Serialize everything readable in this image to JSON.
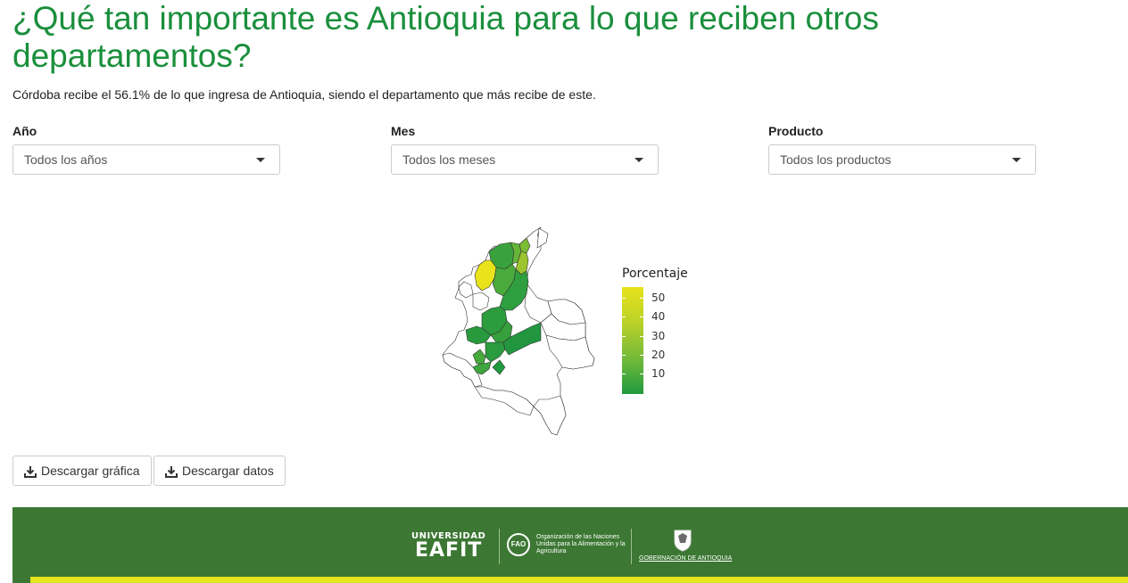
{
  "header": {
    "title": "¿Qué tan importante es Antioquia para lo que reciben otros departamentos?",
    "subtitle": "Córdoba recibe el 56.1% de lo que ingresa de Antioquia, siendo el departamento que más recibe de este."
  },
  "filters": {
    "year": {
      "label": "Año",
      "value": "Todos los años"
    },
    "month": {
      "label": "Mes",
      "value": "Todos los meses"
    },
    "product": {
      "label": "Producto",
      "value": "Todos los productos"
    }
  },
  "map": {
    "legend_title": "Porcentaje",
    "legend_ticks": [
      "50",
      "40",
      "30",
      "20",
      "10"
    ],
    "legend_range": [
      0,
      56.1
    ],
    "colors": {
      "high": "#e8e31a",
      "mid": "#9cc42e",
      "low": "#1f9a3f",
      "none": "#ffffff"
    }
  },
  "buttons": {
    "download_chart": "Descargar gráfica",
    "download_data": "Descargar datos"
  },
  "footer": {
    "eafit_top": "UNIVERSIDAD",
    "eafit_name": "EAFIT",
    "fao_badge": "FAO",
    "fao_text": "Organización de las Naciones Unidas para la Alimentación y la Agricultura",
    "gob_text": "GOBERNACIÓN DE ANTIOQUIA",
    "colors": {
      "bar": "#3c7733",
      "accent": "#e6e41b"
    }
  }
}
